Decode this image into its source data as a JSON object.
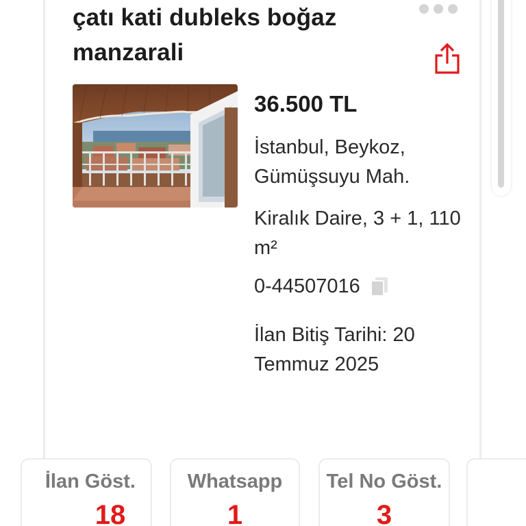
{
  "listing": {
    "title": "çatı kati dubleks boğaz manzarali",
    "price": "36.500 TL",
    "location": "İstanbul, Beykoz, Gümüşsuyu Mah.",
    "property": "Kiralık Daire, 3 + 1, 110 m²",
    "listing_id": "0-44507016",
    "end_date": "İlan Bitiş Tarihi: 20 Temmuz 2025"
  },
  "icons": {
    "more": "more-dots-icon",
    "share": "share-icon",
    "copy": "copy-icon"
  },
  "stats": [
    {
      "label": "İlan Göst.",
      "value": "18"
    },
    {
      "label": "Whatsapp",
      "value": "1"
    },
    {
      "label": "Tel No Göst.",
      "value": "3"
    }
  ],
  "colors": {
    "accent": "#e11b1b",
    "label_gray": "#7a7a7a",
    "text_dark": "#1c1c1c",
    "border": "#ececec"
  }
}
